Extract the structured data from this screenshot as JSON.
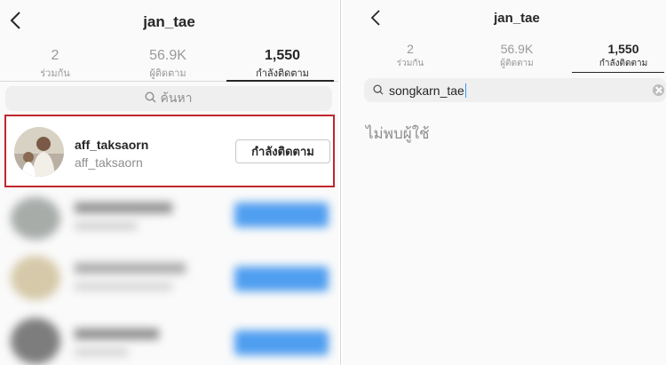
{
  "left": {
    "header": {
      "title": "jan_tae"
    },
    "stats": [
      {
        "value": "2",
        "label": "ร่วมกัน"
      },
      {
        "value": "56.9K",
        "label": "ผู้ติดตาม"
      },
      {
        "value": "1,550",
        "label": "กำลังติดตาม"
      }
    ],
    "search": {
      "placeholder": "ค้นหา"
    },
    "user": {
      "username": "aff_taksaorn",
      "full_name": "aff_taksaorn",
      "button_label": "กำลังติดตาม"
    }
  },
  "right": {
    "header": {
      "title": "jan_tae"
    },
    "stats": [
      {
        "value": "2",
        "label": "ร่วมกัน"
      },
      {
        "value": "56.9K",
        "label": "ผู้ติดตาม"
      },
      {
        "value": "1,550",
        "label": "กำลังติดตาม"
      }
    ],
    "search": {
      "query": "songkarn_tae"
    },
    "empty_message": "ไม่พบผู้ใช้"
  },
  "colors": {
    "highlight_border": "#c0262d",
    "follow_blue": "#3897f0",
    "text_primary": "#262626",
    "text_secondary": "#999999"
  },
  "icons": [
    "back-arrow-icon",
    "search-icon",
    "clear-icon"
  ]
}
